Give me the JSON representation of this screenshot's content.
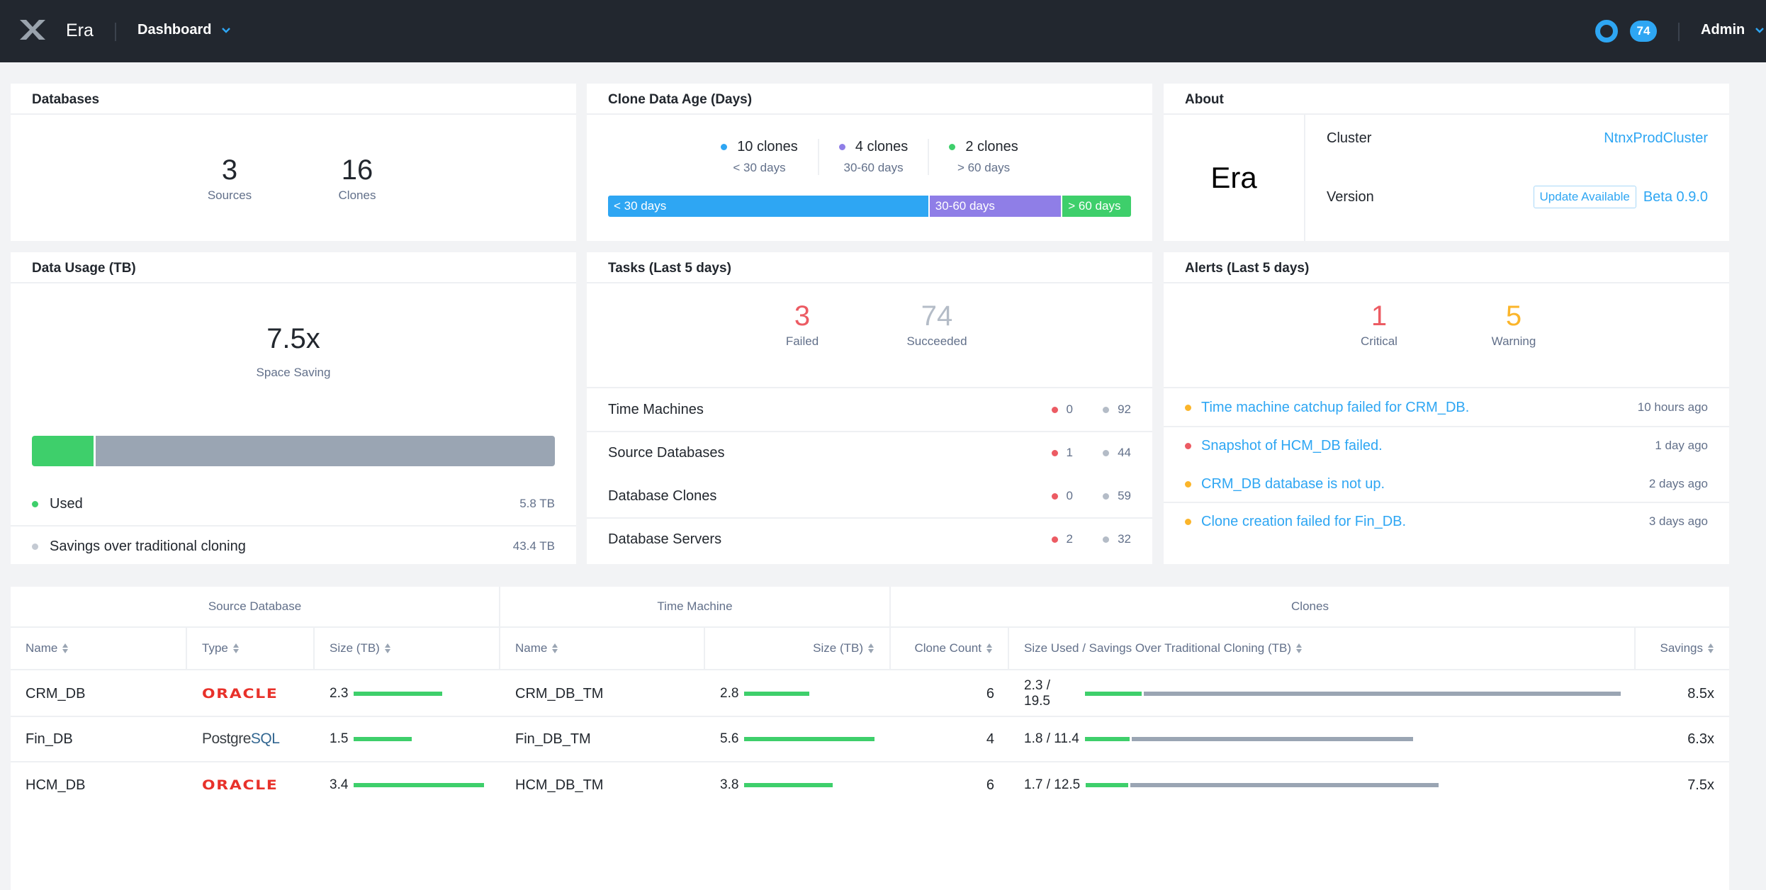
{
  "header": {
    "app_name": "Era",
    "nav_label": "Dashboard",
    "notification_count": "74",
    "user_label": "Admin"
  },
  "colors": {
    "accent": "#2ea6f3",
    "green": "#3ecf6b",
    "purple": "#8f7ee7",
    "gray": "#9aa5b3",
    "critical": "#ec5b63",
    "warning": "#fbb52a",
    "header_bg": "#22272f"
  },
  "databases": {
    "title": "Databases",
    "stats": [
      {
        "value": "3",
        "label": "Sources"
      },
      {
        "value": "16",
        "label": "Clones"
      }
    ]
  },
  "clone_age": {
    "title": "Clone Data Age (Days)",
    "buckets": [
      {
        "count_label": "10 clones",
        "range": "< 30 days",
        "count": 10,
        "color": "#2ea6f3"
      },
      {
        "count_label": "4 clones",
        "range": "30-60 days",
        "count": 4,
        "color": "#8f7ee7"
      },
      {
        "count_label": "2 clones",
        "range": "> 60 days",
        "count": 2,
        "color": "#3ecf6b"
      }
    ]
  },
  "about": {
    "title": "About",
    "product": "Era",
    "cluster_label": "Cluster",
    "cluster_value": "NtnxProdCluster",
    "version_label": "Version",
    "update_button": "Update Available",
    "version_value": "Beta 0.9.0"
  },
  "data_usage": {
    "title": "Data Usage (TB)",
    "ratio": "7.5x",
    "ratio_label": "Space Saving",
    "used_tb": 5.8,
    "savings_tb": 43.4,
    "rows": [
      {
        "label": "Used",
        "value": "5.8 TB",
        "color": "#3ecf6b"
      },
      {
        "label": "Savings over traditional cloning",
        "value": "43.4 TB",
        "color": "#c4cad3"
      }
    ]
  },
  "tasks": {
    "title": "Tasks (Last 5 days)",
    "failed": "3",
    "failed_label": "Failed",
    "succeeded": "74",
    "succeeded_label": "Succeeded",
    "rows": [
      {
        "label": "Time Machines",
        "failed": "0",
        "succeeded": "92"
      },
      {
        "label": "Source Databases",
        "failed": "1",
        "succeeded": "44"
      },
      {
        "label": "Database Clones",
        "failed": "0",
        "succeeded": "59"
      },
      {
        "label": "Database Servers",
        "failed": "2",
        "succeeded": "32"
      }
    ]
  },
  "alerts": {
    "title": "Alerts (Last 5 days)",
    "critical": "1",
    "critical_label": "Critical",
    "warning": "5",
    "warning_label": "Warning",
    "items": [
      {
        "text": "Time machine catchup failed for CRM_DB.",
        "time": "10 hours ago",
        "severity": "warning"
      },
      {
        "text": "Snapshot of HCM_DB failed.",
        "time": "1 day ago",
        "severity": "critical"
      },
      {
        "text": "CRM_DB database is not up.",
        "time": "2 days ago",
        "severity": "warning"
      },
      {
        "text": "Clone creation failed for Fin_DB.",
        "time": "3 days ago",
        "severity": "warning"
      }
    ]
  },
  "table": {
    "groups": [
      "Source Database",
      "Time Machine",
      "Clones"
    ],
    "columns": [
      "Name",
      "Type",
      "Size (TB)",
      "Name",
      "Size (TB)",
      "Clone Count",
      "Size Used / Savings Over Traditional Cloning (TB)",
      "Savings"
    ],
    "rows": [
      {
        "name": "CRM_DB",
        "type": "Oracle",
        "size": "2.3",
        "size_val": 2.3,
        "tm_name": "CRM_DB_TM",
        "tm_size": "2.8",
        "tm_size_val": 2.8,
        "clone_count": "6",
        "used_savings": "2.3 / 19.5",
        "used": 2.3,
        "saved": 19.5,
        "savings": "8.5x"
      },
      {
        "name": "Fin_DB",
        "type": "PostgreSQL",
        "size": "1.5",
        "size_val": 1.5,
        "tm_name": "Fin_DB_TM",
        "tm_size": "5.6",
        "tm_size_val": 5.6,
        "clone_count": "4",
        "used_savings": "1.8 / 11.4",
        "used": 1.8,
        "saved": 11.4,
        "savings": "6.3x"
      },
      {
        "name": "HCM_DB",
        "type": "Oracle",
        "size": "3.4",
        "size_val": 3.4,
        "tm_name": "HCM_DB_TM",
        "tm_size": "3.8",
        "tm_size_val": 3.8,
        "clone_count": "6",
        "used_savings": "1.7 / 12.5",
        "used": 1.7,
        "saved": 12.5,
        "savings": "7.5x"
      }
    ],
    "logos": {
      "oracle": "ORACLE",
      "postgres_a": "Postgre",
      "postgres_b": "SQL"
    }
  }
}
